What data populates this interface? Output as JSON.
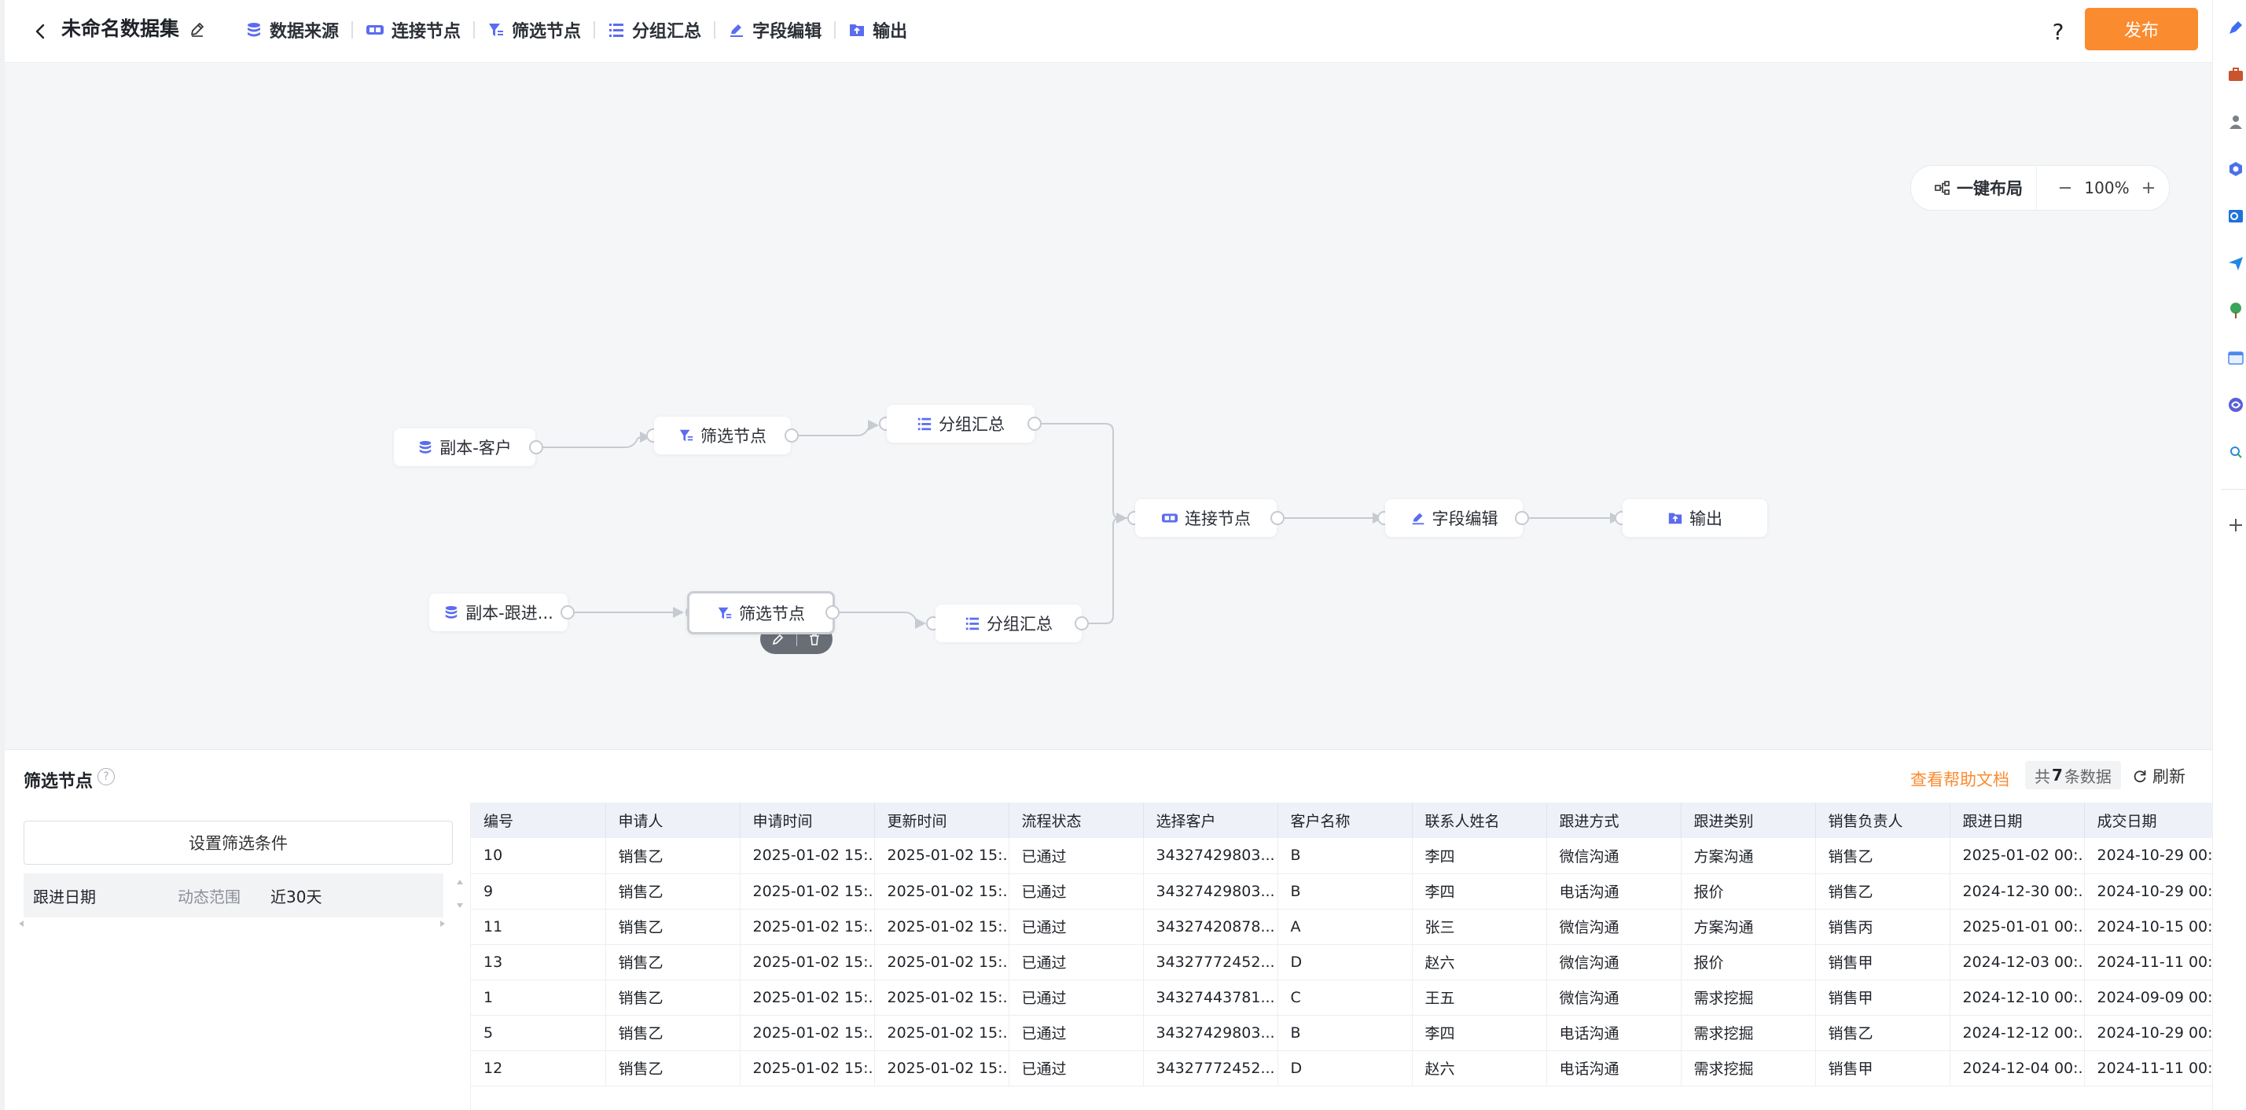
{
  "header": {
    "title": "未命名数据集",
    "toolbar": [
      "数据来源",
      "连接节点",
      "筛选节点",
      "分组汇总",
      "字段编辑",
      "输出"
    ],
    "help": "?",
    "publish": "发布"
  },
  "canvas": {
    "layout_btn": "一键布局",
    "zoom": "100%",
    "nodes": {
      "src1": "副本-客户",
      "filter1": "筛选节点",
      "group1": "分组汇总",
      "src2": "副本-跟进...",
      "filter2": "筛选节点",
      "group2": "分组汇总",
      "join": "连接节点",
      "edit": "字段编辑",
      "output": "输出"
    }
  },
  "panel": {
    "title": "筛选节点",
    "help_doc": "查看帮助文档",
    "count_prefix": "共",
    "count": "7",
    "count_suffix": "条数据",
    "refresh": "刷新",
    "filter_btn": "设置筛选条件",
    "filter": {
      "field": "跟进日期",
      "op": "动态范围",
      "value": "近30天"
    }
  },
  "table": {
    "columns": [
      "编号",
      "申请人",
      "申请时间",
      "更新时间",
      "流程状态",
      "选择客户",
      "客户名称",
      "联系人姓名",
      "跟进方式",
      "跟进类别",
      "销售负责人",
      "跟进日期",
      "成交日期"
    ],
    "rows": [
      [
        "10",
        "销售乙",
        "2025-01-02 15:...",
        "2025-01-02 15:...",
        "已通过",
        "34327429803...",
        "B",
        "李四",
        "微信沟通",
        "方案沟通",
        "销售乙",
        "2025-01-02 00:...",
        "2024-10-29 00:..."
      ],
      [
        "9",
        "销售乙",
        "2025-01-02 15:...",
        "2025-01-02 15:...",
        "已通过",
        "34327429803...",
        "B",
        "李四",
        "电话沟通",
        "报价",
        "销售乙",
        "2024-12-30 00:...",
        "2024-10-29 00:..."
      ],
      [
        "11",
        "销售乙",
        "2025-01-02 15:...",
        "2025-01-02 15:...",
        "已通过",
        "34327420878...",
        "A",
        "张三",
        "微信沟通",
        "方案沟通",
        "销售丙",
        "2025-01-01 00:...",
        "2024-10-15 00:..."
      ],
      [
        "13",
        "销售乙",
        "2025-01-02 15:...",
        "2025-01-02 15:...",
        "已通过",
        "34327772452...",
        "D",
        "赵六",
        "微信沟通",
        "报价",
        "销售甲",
        "2024-12-03 00:...",
        "2024-11-11 00:..."
      ],
      [
        "1",
        "销售乙",
        "2025-01-02 15:...",
        "2025-01-02 15:...",
        "已通过",
        "34327443781...",
        "C",
        "王五",
        "微信沟通",
        "需求挖掘",
        "销售甲",
        "2024-12-10 00:...",
        "2024-09-09 00:..."
      ],
      [
        "5",
        "销售乙",
        "2025-01-02 15:...",
        "2025-01-02 15:...",
        "已通过",
        "34327429803...",
        "B",
        "李四",
        "电话沟通",
        "需求挖掘",
        "销售乙",
        "2024-12-12 00:...",
        "2024-10-29 00:..."
      ],
      [
        "12",
        "销售乙",
        "2025-01-02 15:...",
        "2025-01-02 15:...",
        "已通过",
        "34327772452...",
        "D",
        "赵六",
        "电话沟通",
        "需求挖掘",
        "销售甲",
        "2024-12-04 00:...",
        "2024-11-11 00:..."
      ]
    ]
  },
  "colors": {
    "accent": "#fb8b2f",
    "node_icon": "#5b6cf0",
    "canvas_bg": "#f5f6f8"
  },
  "sidebar_icons": [
    "pen-app-icon",
    "briefcase-app-icon",
    "contacts-app-icon",
    "hexagon-app-icon",
    "outlook-app-icon",
    "send-app-icon",
    "tree-app-icon",
    "calendar-app-icon",
    "swirl-app-icon",
    "search-app-icon",
    "add-icon"
  ]
}
